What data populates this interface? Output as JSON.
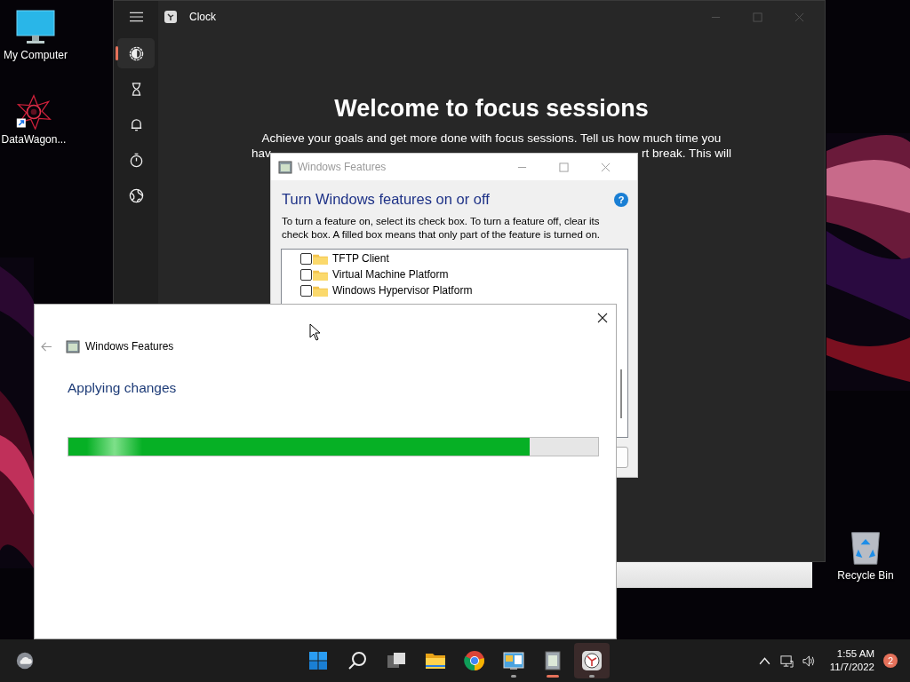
{
  "desktop_icons": [
    {
      "kind": "computer",
      "label": "My Computer"
    },
    {
      "kind": "shortcut",
      "label": "DataWagon..."
    },
    {
      "kind": "recycle",
      "label": "Recycle Bin"
    }
  ],
  "clock_window": {
    "title": "Clock",
    "nav": [
      {
        "kind": "focus",
        "selected": true
      },
      {
        "kind": "timer",
        "selected": false
      },
      {
        "kind": "alarm",
        "selected": false
      },
      {
        "kind": "stopwatch",
        "selected": false
      },
      {
        "kind": "world",
        "selected": false
      }
    ],
    "heading": "Welcome to focus sessions",
    "body_line": "Achieve your goals and get more done with focus sessions. Tell us how much time you",
    "body_fragments": [
      "hav",
      "rt break. This will"
    ]
  },
  "features_window": {
    "title": "Windows Features",
    "active": false,
    "heading": "Turn Windows features on or off",
    "help": "?",
    "description": "To turn a feature on, select its check box. To turn a feature off, clear its check box. A filled box means that only part of the feature is turned on.",
    "features": [
      {
        "label": "TFTP Client",
        "checked": false
      },
      {
        "label": "Virtual Machine Platform",
        "checked": false
      },
      {
        "label": "Windows Hypervisor Platform",
        "checked": false
      }
    ]
  },
  "progress_dialog": {
    "title": "Windows Features",
    "status": "Applying changes",
    "level": 0.87
  },
  "taskbar": {
    "apps": [
      {
        "kind": "start",
        "running": false,
        "focused": false
      },
      {
        "kind": "search",
        "running": false,
        "focused": false
      },
      {
        "kind": "taskview",
        "running": false,
        "focused": false
      },
      {
        "kind": "folder",
        "running": false,
        "focused": false
      },
      {
        "kind": "browser",
        "running": false,
        "focused": false
      },
      {
        "kind": "control",
        "running": true,
        "focused": false
      },
      {
        "kind": "features",
        "running": true,
        "focused": true
      },
      {
        "kind": "clock",
        "running": true,
        "focused": false
      }
    ],
    "time": "1:55 AM",
    "date": "11/7/2022",
    "notifications": "2"
  }
}
